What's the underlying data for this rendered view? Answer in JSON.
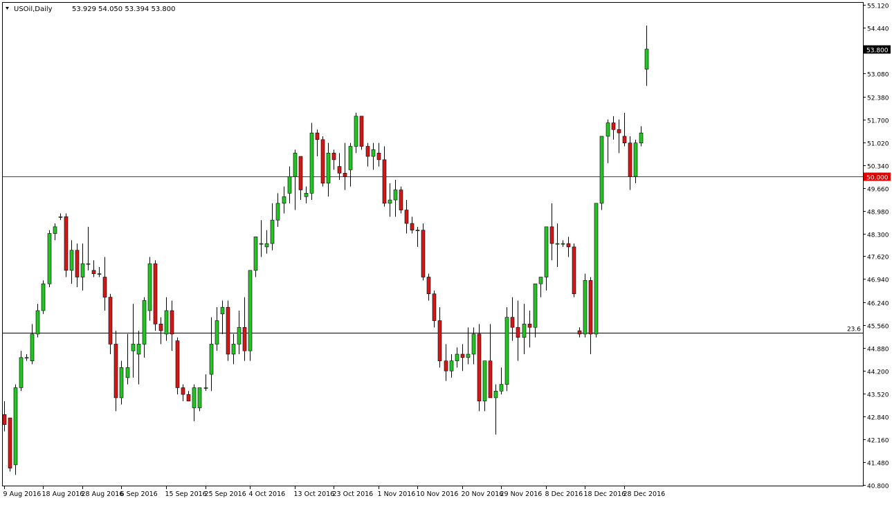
{
  "header": {
    "symbol": "USOil,Daily",
    "ohlc": "53.929 54.050 53.394 53.800",
    "menu_icon": "triangle-down-icon"
  },
  "colors": {
    "background": "#ffffff",
    "bull": "#22c322",
    "bear": "#d01818",
    "wick": "#000000",
    "level_red": "#e00000",
    "level_black": "#000000",
    "price_label_bg": "#000000"
  },
  "chart_data": {
    "type": "candlestick",
    "title": "USOil,Daily",
    "xlabel": "",
    "ylabel": "",
    "ylim": [
      40.8,
      55.12
    ],
    "y_ticks": [
      "55.120",
      "54.440",
      "53.800",
      "53.080",
      "52.380",
      "51.700",
      "51.020",
      "50.340",
      "50.000",
      "49.660",
      "48.980",
      "48.300",
      "47.620",
      "46.940",
      "46.240",
      "45.560",
      "44.880",
      "44.200",
      "43.520",
      "42.840",
      "42.160",
      "41.480",
      "40.800"
    ],
    "x_ticks": [
      {
        "label": "9 Aug 2016",
        "index": 0
      },
      {
        "label": "18 Aug 2016",
        "index": 7
      },
      {
        "label": "28 Aug 2016",
        "index": 14
      },
      {
        "label": "6 Sep 2016",
        "index": 21
      },
      {
        "label": "15 Sep 2016",
        "index": 29
      },
      {
        "label": "25 Sep 2016",
        "index": 36
      },
      {
        "label": "4 Oct 2016",
        "index": 44
      },
      {
        "label": "13 Oct 2016",
        "index": 52
      },
      {
        "label": "23 Oct 2016",
        "index": 59
      },
      {
        "label": "1 Nov 2016",
        "index": 67
      },
      {
        "label": "10 Nov 2016",
        "index": 74
      },
      {
        "label": "20 Nov 2016",
        "index": 82
      },
      {
        "label": "29 Nov 2016",
        "index": 89
      },
      {
        "label": "8 Dec 2016",
        "index": 97
      },
      {
        "label": "18 Dec 2016",
        "index": 104
      },
      {
        "label": "28 Dec 2016",
        "index": 111
      }
    ],
    "current_price": "53.800",
    "levels": [
      {
        "name": "50.000",
        "value": 50.0,
        "label": "50.000",
        "color": "#e00000"
      },
      {
        "name": "23.6",
        "value": 45.33,
        "label": "23.6",
        "color": "#000000"
      }
    ],
    "candles": [
      [
        42.9,
        43.3,
        42.4,
        42.6
      ],
      [
        42.8,
        42.8,
        41.2,
        41.3
      ],
      [
        41.4,
        43.8,
        41.1,
        43.7
      ],
      [
        43.7,
        44.8,
        43.6,
        44.6
      ],
      [
        44.6,
        44.7,
        44.5,
        44.6
      ],
      [
        44.5,
        45.6,
        44.4,
        45.3
      ],
      [
        45.3,
        46.2,
        45.2,
        46.0
      ],
      [
        46.0,
        46.9,
        45.9,
        46.8
      ],
      [
        46.8,
        48.4,
        46.7,
        48.3
      ],
      [
        48.3,
        48.6,
        48.1,
        48.5
      ],
      [
        48.8,
        48.9,
        48.7,
        48.8
      ],
      [
        48.8,
        48.9,
        47.0,
        47.2
      ],
      [
        47.2,
        48.1,
        46.8,
        47.8
      ],
      [
        47.8,
        48.0,
        46.7,
        47.0
      ],
      [
        47.0,
        48.0,
        46.6,
        47.4
      ],
      [
        47.4,
        48.5,
        47.2,
        47.4
      ],
      [
        47.2,
        47.5,
        47.0,
        47.1
      ],
      [
        47.1,
        47.3,
        47.0,
        47.1
      ],
      [
        47.0,
        47.6,
        46.0,
        46.4
      ],
      [
        46.4,
        46.5,
        44.7,
        45.0
      ],
      [
        45.0,
        45.4,
        43.0,
        43.4
      ],
      [
        43.4,
        44.5,
        43.2,
        44.3
      ],
      [
        44.0,
        45.3,
        43.8,
        44.3
      ],
      [
        44.8,
        46.2,
        44.0,
        45.0
      ],
      [
        44.7,
        45.4,
        43.8,
        45.0
      ],
      [
        45.0,
        46.4,
        44.6,
        46.3
      ],
      [
        46.0,
        47.6,
        45.7,
        47.4
      ],
      [
        47.4,
        47.5,
        45.4,
        45.6
      ],
      [
        45.6,
        45.8,
        45.0,
        45.4
      ],
      [
        45.3,
        46.4,
        45.1,
        46.0
      ],
      [
        46.0,
        46.3,
        44.8,
        45.3
      ],
      [
        45.1,
        45.2,
        43.5,
        43.7
      ],
      [
        43.7,
        43.8,
        43.3,
        43.5
      ],
      [
        43.5,
        43.6,
        43.3,
        43.3
      ],
      [
        43.1,
        43.8,
        42.7,
        43.7
      ],
      [
        43.1,
        43.7,
        43.0,
        43.7
      ],
      [
        43.7,
        44.1,
        43.6,
        43.7
      ],
      [
        44.1,
        45.8,
        43.6,
        45.0
      ],
      [
        45.0,
        46.1,
        44.8,
        45.7
      ],
      [
        45.9,
        46.3,
        45.3,
        46.1
      ],
      [
        46.1,
        46.3,
        44.5,
        44.7
      ],
      [
        44.7,
        45.3,
        44.4,
        45.0
      ],
      [
        45.0,
        46.0,
        44.7,
        45.5
      ],
      [
        45.5,
        46.4,
        44.5,
        44.8
      ],
      [
        44.8,
        46.5,
        44.5,
        47.2
      ],
      [
        47.2,
        48.2,
        47.0,
        48.2
      ],
      [
        48.0,
        48.7,
        47.6,
        48.0
      ],
      [
        47.9,
        48.4,
        47.7,
        48.0
      ],
      [
        48.0,
        49.2,
        47.8,
        48.7
      ],
      [
        48.7,
        49.5,
        48.5,
        49.2
      ],
      [
        49.2,
        49.7,
        48.9,
        49.4
      ],
      [
        49.5,
        50.3,
        49.2,
        50.0
      ],
      [
        50.0,
        50.8,
        49.0,
        50.7
      ],
      [
        50.6,
        50.6,
        49.3,
        49.6
      ],
      [
        49.4,
        49.7,
        49.2,
        49.5
      ],
      [
        49.5,
        51.6,
        49.3,
        51.3
      ],
      [
        51.3,
        51.4,
        50.6,
        51.1
      ],
      [
        51.1,
        51.2,
        49.7,
        49.8
      ],
      [
        49.8,
        51.0,
        49.4,
        50.7
      ],
      [
        50.7,
        50.8,
        50.2,
        50.5
      ],
      [
        50.3,
        50.7,
        49.9,
        50.1
      ],
      [
        50.1,
        51.0,
        49.6,
        50.0
      ],
      [
        50.2,
        51.0,
        49.7,
        50.9
      ],
      [
        50.9,
        51.9,
        50.7,
        51.8
      ],
      [
        51.8,
        51.8,
        50.8,
        50.9
      ],
      [
        50.9,
        51.0,
        50.3,
        50.6
      ],
      [
        50.6,
        51.0,
        50.2,
        50.8
      ],
      [
        50.7,
        51.0,
        50.3,
        50.5
      ],
      [
        50.5,
        50.9,
        49.1,
        49.2
      ],
      [
        49.2,
        49.8,
        48.8,
        49.3
      ],
      [
        49.3,
        49.9,
        48.8,
        49.6
      ],
      [
        49.6,
        49.7,
        48.9,
        49.0
      ],
      [
        49.0,
        49.3,
        48.3,
        48.6
      ],
      [
        48.6,
        48.8,
        48.3,
        48.4
      ],
      [
        48.4,
        48.5,
        47.9,
        48.4
      ],
      [
        48.4,
        48.6,
        46.9,
        47.0
      ],
      [
        47.0,
        47.1,
        46.3,
        46.5
      ],
      [
        46.5,
        46.6,
        45.5,
        45.7
      ],
      [
        45.7,
        46.1,
        44.3,
        44.5
      ],
      [
        44.5,
        45.0,
        43.9,
        44.2
      ],
      [
        44.2,
        44.7,
        44.0,
        44.5
      ],
      [
        44.5,
        44.9,
        44.3,
        44.7
      ],
      [
        44.7,
        45.0,
        44.2,
        44.6
      ],
      [
        44.6,
        45.5,
        44.4,
        44.7
      ],
      [
        44.7,
        45.5,
        44.4,
        45.3
      ],
      [
        45.3,
        45.6,
        43.0,
        43.3
      ],
      [
        43.3,
        44.4,
        43.0,
        44.5
      ],
      [
        44.5,
        45.6,
        43.5,
        43.4
      ],
      [
        43.4,
        43.8,
        42.3,
        43.6
      ],
      [
        43.6,
        44.3,
        43.5,
        43.8
      ],
      [
        43.8,
        46.1,
        43.6,
        45.8
      ],
      [
        45.8,
        46.4,
        45.1,
        45.5
      ],
      [
        45.5,
        46.3,
        44.5,
        45.2
      ],
      [
        45.2,
        46.2,
        44.7,
        45.6
      ],
      [
        45.6,
        46.0,
        44.9,
        45.5
      ],
      [
        45.5,
        46.2,
        45.2,
        46.8
      ],
      [
        46.8,
        47.0,
        46.4,
        47.0
      ],
      [
        47.0,
        48.4,
        46.6,
        48.5
      ],
      [
        48.5,
        49.2,
        47.5,
        48.0
      ],
      [
        48.0,
        48.6,
        47.3,
        48.0
      ],
      [
        48.0,
        48.1,
        47.9,
        48.0
      ],
      [
        48.0,
        48.2,
        47.6,
        47.9
      ],
      [
        47.9,
        48.0,
        46.4,
        46.5
      ],
      [
        45.4,
        45.5,
        45.2,
        45.3
      ],
      [
        45.3,
        47.1,
        45.2,
        46.9
      ],
      [
        46.9,
        47.0,
        44.7,
        45.3
      ],
      [
        45.3,
        49.2,
        45.2,
        49.2
      ],
      [
        49.2,
        49.5,
        49.0,
        51.2
      ],
      [
        51.2,
        51.7,
        50.4,
        51.6
      ],
      [
        51.6,
        51.8,
        51.1,
        51.4
      ],
      [
        51.4,
        51.7,
        50.7,
        51.3
      ],
      [
        51.2,
        51.9,
        50.9,
        51.0
      ],
      [
        51.0,
        51.2,
        49.6,
        50.0
      ],
      [
        50.0,
        51.1,
        49.8,
        51.0
      ],
      [
        51.0,
        51.5,
        50.9,
        51.3
      ],
      [
        53.2,
        54.5,
        52.7,
        53.8
      ]
    ]
  }
}
